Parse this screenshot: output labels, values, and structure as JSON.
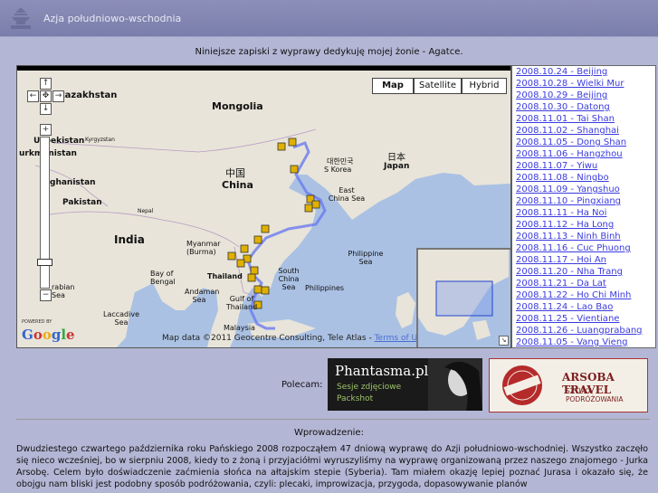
{
  "header": {
    "title": "Azja  południowo-wschodnia"
  },
  "dedication": "Niniejsze zapiski z wyprawy dedykuję mojej żonie - Agatce.",
  "map": {
    "types": [
      "Map",
      "Satellite",
      "Hybrid"
    ],
    "active_type": "Map",
    "labels": {
      "kazakhstan": "kazakhstan",
      "mongolia": "Mongolia",
      "uzbekistan": "Uzbekistan",
      "kyrgyzstan": "Kyrgyzstan",
      "turkmenistan": "urkmenistan",
      "afghanistan": "ghanistan",
      "pakistan": "Pakistan",
      "nepal": "Nepal",
      "india": "India",
      "china_cn": "中国",
      "china": "China",
      "korea_kr": "대한민국",
      "s_korea": "S Korea",
      "japan_jp": "日本",
      "japan": "Japan",
      "east_china_sea": "East China Sea",
      "myanmar": "Myanmar (Burma)",
      "thailand": "Thailand",
      "bay_of_bengal": "Bay of Bengal",
      "andaman_sea": "Andaman Sea",
      "arabian_sea": "rabian Sea",
      "laccadive_sea": "Laccadive Sea",
      "south_china_sea": "South China Sea",
      "philippines": "Philippines",
      "philippine_sea": "Philippine Sea",
      "gulf_of_thailand": "Gulf of Thailand",
      "malaysia": "Malaysia"
    },
    "powered_by": "POWERED BY",
    "google": "Google",
    "attribution": "Map data ©2011 Geocentre Consulting, Tele Atlas -",
    "terms": "Terms of Use"
  },
  "itinerary": [
    "2008.10.24 - Beijing",
    "2008.10.28 - Wielki Mur",
    "2008.10.29 - Beijing",
    "2008.10.30 - Datong",
    "2008.11.01 - Tai Shan",
    "2008.11.02 - Shanghai",
    "2008.11.05 - Dong Shan",
    "2008.11.06 - Hangzhou",
    "2008.11.07 - Yiwu",
    "2008.11.08 - Ningbo",
    "2008.11.09 - Yangshuo",
    "2008.11.10 - Pingxiang",
    "2008.11.11 - Ha Noi",
    "2008.11.12 - Ha Long",
    "2008.11.13 - Ninh Binh",
    "2008.11.16 - Cuc Phuong",
    "2008.11.17 - Hoi An",
    "2008.11.20 - Nha Trang",
    "2008.11.21 - Da Lat",
    "2008.11.22 - Ho Chi Minh",
    "2008.11.24 - Lao Bao",
    "2008.11.25 - Vientiane",
    "2008.11.26 - Luangprabang",
    "2008.11.05 - Vang Vieng"
  ],
  "sponsors": {
    "label": "Polecam:",
    "phantasma": {
      "title": "Phantasma.pl",
      "line1": "Sesje zdjęciowe",
      "line2": "Packshot"
    },
    "arsoba": {
      "title": "ARSOBA TRAVEL",
      "subtitle": "SZTUKA PODRÓŻOWANIA",
      "stamp": "ARSOBA"
    }
  },
  "intro": {
    "heading": "Wprowadzenie:",
    "text": "Dwudziestego czwartego października roku Pańskiego 2008 rozpocząłem 47 dniową wyprawę do Azji południowo-wschodniej. Wszystko zaczęło się nieco wcześniej, bo w sierpniu 2008, kiedy to z żoną i przyjaciółmi wyruszyliśmy na wyprawę organizowaną przez naszego znajomego - Jurka Arsobę. Celem było doświadczenie zaćmienia słońca na ałtajskim stepie (Syberia). Tam miałem okazję lepiej poznać Jurasa i okazało się, że obojgu nam bliski jest podobny sposób podróżowania, czyli: plecaki, improwizacja, przygoda, dopasowywanie planów"
  },
  "colors": {
    "background": "#b3b6d4",
    "header": "#7e82ae",
    "link": "#3a3adf",
    "route": "#6a7bef",
    "marker": "#e0b000"
  }
}
